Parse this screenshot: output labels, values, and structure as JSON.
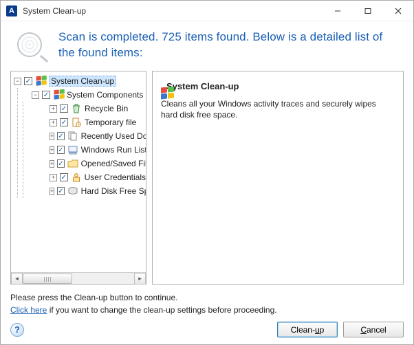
{
  "window": {
    "title": "System Clean-up",
    "app_letter": "A"
  },
  "header": {
    "message": "Scan is completed. 725 items found. Below is a detailed list of the found items:"
  },
  "tree": {
    "root": {
      "label": "System Clean-up",
      "icon": "windows-logo-icon"
    },
    "group": {
      "label": "System Components",
      "icon": "windows-logo-icon"
    },
    "items": [
      {
        "label": "Recycle Bin",
        "icon": "recycle-bin-icon"
      },
      {
        "label": "Temporary file",
        "icon": "temp-file-icon"
      },
      {
        "label": "Recently Used Docum",
        "icon": "recent-docs-icon"
      },
      {
        "label": "Windows Run List",
        "icon": "run-list-icon"
      },
      {
        "label": "Opened/Saved Files H",
        "icon": "opened-saved-icon"
      },
      {
        "label": "User Credentials",
        "icon": "credentials-icon"
      },
      {
        "label": "Hard Disk Free Space",
        "icon": "hard-disk-icon"
      }
    ]
  },
  "details": {
    "title": "System Clean-up",
    "description": "Cleans all your Windows activity traces and securely wipes hard disk free space."
  },
  "footer": {
    "instruction": "Please press the Clean-up button to continue.",
    "link_text": "Click here",
    "link_tail": " if you want to change the clean-up settings before proceeding.",
    "cleanup_btn": "Clean-up",
    "cancel_btn": "Cancel",
    "cleanup_u": "u",
    "cleanup_rest": "Clean-",
    "cleanup_tail": "p",
    "cancel_u": "C",
    "cancel_rest": "ancel"
  }
}
